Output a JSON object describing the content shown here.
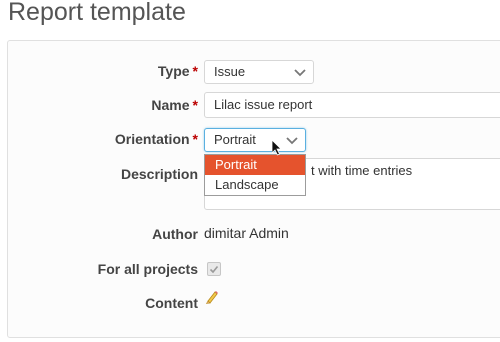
{
  "page": {
    "title": "Report template"
  },
  "form": {
    "type": {
      "label": "Type",
      "required": "*",
      "value": "Issue"
    },
    "name": {
      "label": "Name",
      "required": "*",
      "value": "Lilac issue report"
    },
    "orientation": {
      "label": "Orientation",
      "required": "*",
      "value": "Portrait",
      "options": [
        "Portrait",
        "Landscape"
      ]
    },
    "description": {
      "label": "Description",
      "visible_tail": "t with time entries"
    },
    "author": {
      "label": "Author",
      "value": "dimitar Admin"
    },
    "for_all_projects": {
      "label": "For all projects",
      "checked": true
    },
    "content": {
      "label": "Content",
      "edit_icon": "pencil-icon"
    }
  },
  "colors": {
    "accent": "#e5532d",
    "required": "#bb0000",
    "focus": "#5ab0e0"
  }
}
